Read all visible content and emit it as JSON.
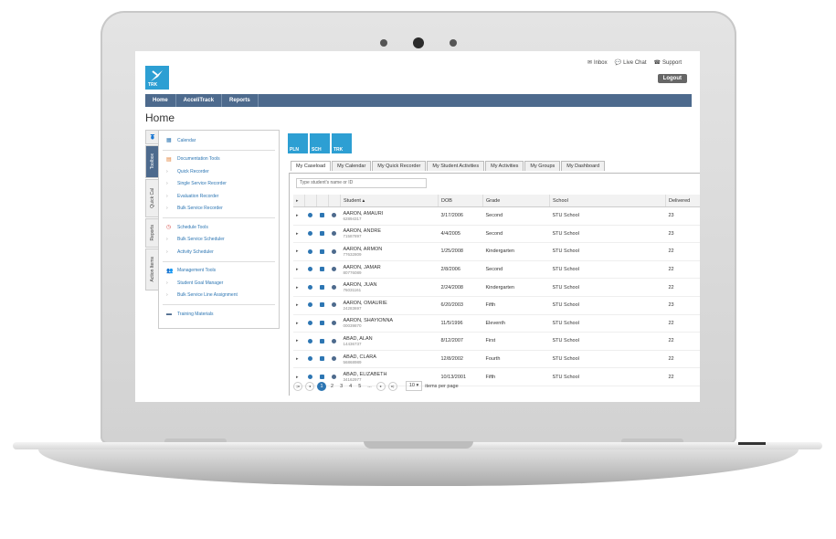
{
  "header": {
    "logo_text": "TRK",
    "links": [
      "Inbox",
      "Live Chat",
      "Support"
    ],
    "logout": "Logout"
  },
  "nav": [
    "Home",
    "AcceliTrack",
    "Reports"
  ],
  "page_title": "Home",
  "side_tabs": [
    "Toolbox",
    "Quick Cal",
    "Reports",
    "Action Items"
  ],
  "toolbox": {
    "calendar": "Calendar",
    "documentation": "Documentation Tools",
    "documentation_items": [
      "Quick Recorder",
      "Single Service Recorder",
      "Evaluation Recorder",
      "Bulk Service Recorder"
    ],
    "schedule": "Schedule Tools",
    "schedule_items": [
      "Bulk Service Scheduler",
      "Activity Scheduler"
    ],
    "management": "Management Tools",
    "management_items": [
      "Student Goal Manager",
      "Bulk Service Line Assignment"
    ],
    "training": "Training Materials"
  },
  "apps": [
    "PLN",
    "SCH",
    "TRK"
  ],
  "tabs": [
    "My Caseload",
    "My Calendar",
    "My Quick Recorder",
    "My Student Activities",
    "My Activities",
    "My Groups",
    "My Dashboard"
  ],
  "search_placeholder": "Type student's name or ID",
  "columns": [
    "Student",
    "DOB",
    "Grade",
    "School",
    "Delivered"
  ],
  "rows": [
    {
      "name": "AARON, AMAURI",
      "id": "62894317",
      "dob": "3/17/2006",
      "grade": "Second",
      "school": "STU School",
      "delivered": "23"
    },
    {
      "name": "AARON, ANDRE",
      "id": "71587897",
      "dob": "4/4/2005",
      "grade": "Second",
      "school": "STU School",
      "delivered": "23"
    },
    {
      "name": "AARON, ARMON",
      "id": "77632809",
      "dob": "1/25/2008",
      "grade": "Kindergarten",
      "school": "STU School",
      "delivered": "22"
    },
    {
      "name": "AARON, JAMAR",
      "id": "80776089",
      "dob": "2/8/2006",
      "grade": "Second",
      "school": "STU School",
      "delivered": "22"
    },
    {
      "name": "AARON, JUAN",
      "id": "76031161",
      "dob": "2/24/2008",
      "grade": "Kindergarten",
      "school": "STU School",
      "delivered": "22"
    },
    {
      "name": "AARON, OMAURIE",
      "id": "24283697",
      "dob": "6/20/2003",
      "grade": "Fifth",
      "school": "STU School",
      "delivered": "23"
    },
    {
      "name": "AARON, SHAYIONNA",
      "id": "00039870",
      "dob": "11/5/1996",
      "grade": "Eleventh",
      "school": "STU School",
      "delivered": "22"
    },
    {
      "name": "ABAD, ALAN",
      "id": "14436737",
      "dob": "8/12/2007",
      "grade": "First",
      "school": "STU School",
      "delivered": "22"
    },
    {
      "name": "ABAD, CLARA",
      "id": "56868989",
      "dob": "12/8/2002",
      "grade": "Fourth",
      "school": "STU School",
      "delivered": "22"
    },
    {
      "name": "ABAD, ELIZABETH",
      "id": "34162977",
      "dob": "10/13/2001",
      "grade": "Fifth",
      "school": "STU School",
      "delivered": "22"
    }
  ],
  "pager": {
    "pages": [
      "1",
      "2",
      "3",
      "4",
      "5",
      "..."
    ],
    "per_page": "10",
    "per_page_label": "items per page"
  },
  "colors": {
    "accent": "#2d9fd3",
    "nav": "#4d6a8d",
    "link": "#2d76b3"
  }
}
